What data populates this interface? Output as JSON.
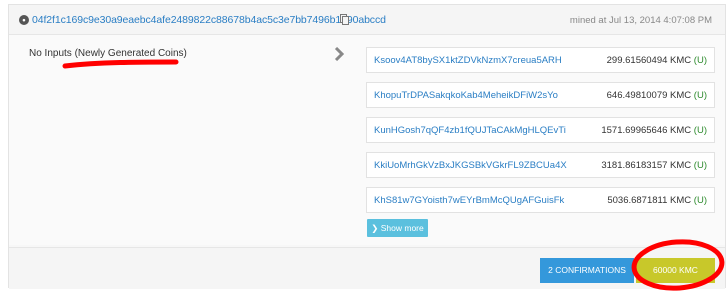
{
  "transaction": {
    "hash": "04f2f1c169c9e30a9eaebc4afe2489822c88678b4ac5c3e7bb7496b1590abccd",
    "mined_text": "mined at Jul 13, 2014 4:07:08 PM"
  },
  "inputs": {
    "label": "No Inputs (Newly Generated Coins)"
  },
  "outputs": [
    {
      "address": "Ksoov4AT8bySX1ktZDVkNzmX7creua5ARH",
      "amount": "299.61560494 KMC",
      "status": "(U)"
    },
    {
      "address": "KhopuTrDPASakqkoKab4MeheikDFiW2sYo",
      "amount": "646.49810079 KMC",
      "status": "(U)"
    },
    {
      "address": "KunHGosh7qQF4zb1fQUJTaCAkMgHLQEvTi",
      "amount": "1571.69965646 KMC",
      "status": "(U)"
    },
    {
      "address": "KkiUoMrhGkVzBxJKGSBkVGkrFL9ZBCUa4X",
      "amount": "3181.86183157 KMC",
      "status": "(U)"
    },
    {
      "address": "KhS81w7GYoisth7wEYrBmMcQUgAFGuisFk",
      "amount": "5036.6871811 KMC",
      "status": "(U)"
    }
  ],
  "show_more_label": "Show more",
  "footer": {
    "confirmations": "2 CONFIRMATIONS",
    "total": "60000 KMC"
  },
  "colors": {
    "link": "#2a7ec4",
    "confirm_button": "#3498db",
    "amount_button": "#c8c82a",
    "show_more_button": "#5bc0de",
    "annotation": "#ff0000"
  },
  "icons": [
    "tx-toggle-icon",
    "copy-icon",
    "chevron-right-icon",
    "chevron-down-icon"
  ]
}
